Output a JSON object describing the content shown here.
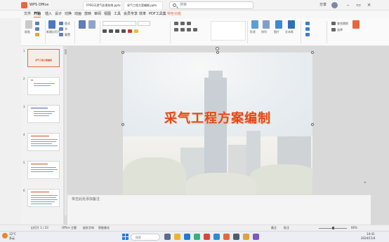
{
  "titlebar": {
    "app_tab": "WPS Office",
    "doc_tab_1": "FPSO天然气处理系统.pptx",
    "doc_tab_2": "采气工程方案编制.pptx",
    "search_placeholder": "搜索",
    "user_label": "分享"
  },
  "menu": {
    "items": [
      "文件",
      "开始",
      "插入",
      "设计",
      "切换",
      "动画",
      "放映",
      "审阅",
      "视图",
      "工具",
      "会员专享",
      "效率",
      "PDF工具集",
      "特色功能"
    ],
    "active_index": 1,
    "special_index": 13
  },
  "ribbon": {
    "labels": {
      "paste": "粘贴",
      "new_slide": "新建幻灯片",
      "layout": "版式",
      "section": "节",
      "reset": "重置",
      "font_name": "",
      "font_size": "",
      "shape": "形状",
      "arrange": "排列",
      "picture": "图片",
      "textbox": "文本框",
      "find": "查找替换",
      "select": "选择"
    }
  },
  "thumbnails": {
    "numbers": [
      "1",
      "2",
      "3",
      "4",
      "5",
      "6"
    ],
    "selected_index": 0,
    "slide1_title": "采气工程方案编制"
  },
  "slide": {
    "title": "采气工程方案编制"
  },
  "notes": {
    "placeholder": "单击此处添加备注"
  },
  "statusbar": {
    "slide_info": "幻灯片 1 / 23",
    "theme": "Office 主题",
    "missing_font": "缺失字体",
    "smart_beautify": "智能美化",
    "notes_btn": "备注",
    "comment_btn": "批注",
    "zoom": "66%"
  },
  "taskbar": {
    "weather_temp": "12°C",
    "weather_desc": "多云",
    "search_placeholder": "搜索",
    "time": "14:41",
    "date": "2024/11/4"
  },
  "colors": {
    "accent": "#e8663d",
    "title_red": "#e04a1c"
  }
}
